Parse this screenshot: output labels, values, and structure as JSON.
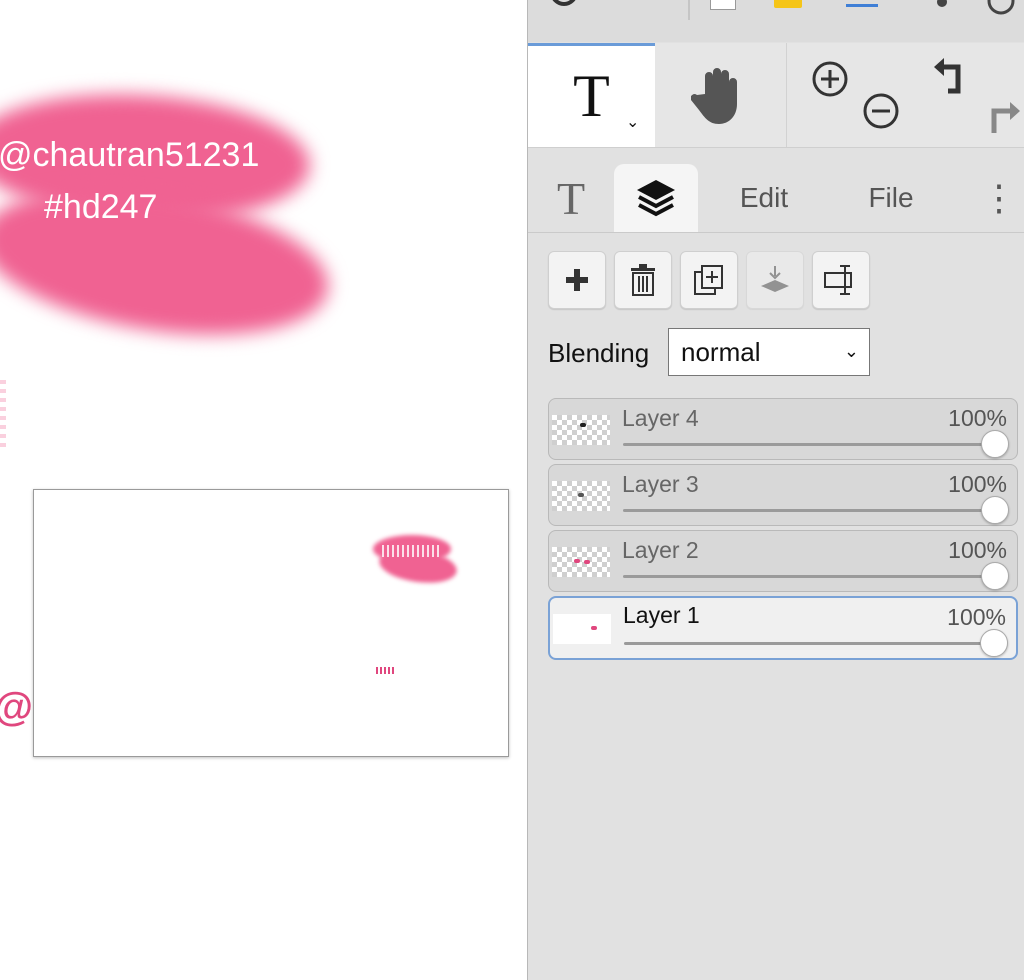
{
  "canvas": {
    "handle_text": "@chautran51231",
    "tag_text": "#hd247",
    "edge_text": "@T",
    "brush_color": "#f06292"
  },
  "toolbar": {
    "text_tool_glyph": "T",
    "text_tool_chevron": "⌄",
    "icons": [
      "text-tool-icon",
      "hand-icon",
      "zoom-in-icon",
      "zoom-out-icon",
      "undo-icon",
      "redo-icon"
    ]
  },
  "tabs": {
    "text_glyph": "T",
    "edit": "Edit",
    "file": "File",
    "more": "⋮"
  },
  "layer_actions": [
    "add-layer",
    "delete-layer",
    "duplicate-layer",
    "merge-down",
    "rename-layer"
  ],
  "blending": {
    "label": "Blending",
    "value": "normal"
  },
  "layers": [
    {
      "name": "Layer 4",
      "opacity": "100%",
      "level": 1.0
    },
    {
      "name": "Layer 3",
      "opacity": "100%",
      "level": 1.0
    },
    {
      "name": "Layer 2",
      "opacity": "100%",
      "level": 1.0
    },
    {
      "name": "Layer 1",
      "opacity": "100%",
      "level": 1.0,
      "selected": true
    }
  ],
  "colors": {
    "accent": "#6a9bd8",
    "panel_bg": "#e1e1e1",
    "pink": "#f06292"
  }
}
